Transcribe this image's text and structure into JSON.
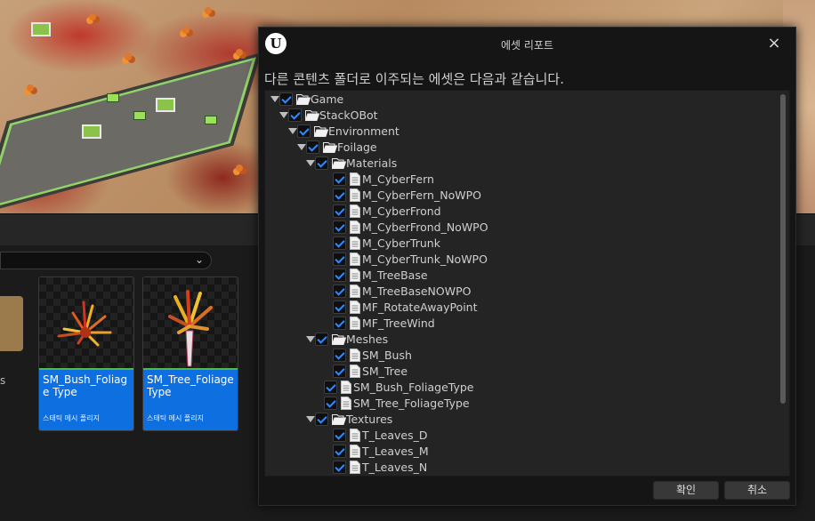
{
  "dialog": {
    "logo": "U",
    "title": "에셋 리포트",
    "close_icon": "×",
    "message": "다른 콘텐츠 폴더로 이주되는 에셋은 다음과 같습니다.",
    "tree": [
      {
        "label": "Game",
        "depth": 0,
        "kind": "folder",
        "expanded": true,
        "checked": true
      },
      {
        "label": "StackOBot",
        "depth": 1,
        "kind": "folder",
        "expanded": true,
        "checked": true
      },
      {
        "label": "Environment",
        "depth": 2,
        "kind": "folder",
        "expanded": true,
        "checked": true
      },
      {
        "label": "Foilage",
        "depth": 3,
        "kind": "folder",
        "expanded": true,
        "checked": true
      },
      {
        "label": "Materials",
        "depth": 4,
        "kind": "folder",
        "expanded": true,
        "checked": true
      },
      {
        "label": "M_CyberFern",
        "depth": 5,
        "kind": "file",
        "checked": true
      },
      {
        "label": "M_CyberFern_NoWPO",
        "depth": 5,
        "kind": "file",
        "checked": true
      },
      {
        "label": "M_CyberFrond",
        "depth": 5,
        "kind": "file",
        "checked": true
      },
      {
        "label": "M_CyberFrond_NoWPO",
        "depth": 5,
        "kind": "file",
        "checked": true
      },
      {
        "label": "M_CyberTrunk",
        "depth": 5,
        "kind": "file",
        "checked": true
      },
      {
        "label": "M_CyberTrunk_NoWPO",
        "depth": 5,
        "kind": "file",
        "checked": true
      },
      {
        "label": "M_TreeBase",
        "depth": 5,
        "kind": "file",
        "checked": true
      },
      {
        "label": "M_TreeBaseNOWPO",
        "depth": 5,
        "kind": "file",
        "checked": true
      },
      {
        "label": "MF_RotateAwayPoint",
        "depth": 5,
        "kind": "file",
        "checked": true
      },
      {
        "label": "MF_TreeWind",
        "depth": 5,
        "kind": "file",
        "checked": true
      },
      {
        "label": "Meshes",
        "depth": 4,
        "kind": "folder",
        "expanded": true,
        "checked": true
      },
      {
        "label": "SM_Bush",
        "depth": 5,
        "kind": "file",
        "checked": true
      },
      {
        "label": "SM_Tree",
        "depth": 5,
        "kind": "file",
        "checked": true
      },
      {
        "label": "SM_Bush_FoliageType",
        "depth": 4,
        "kind": "file",
        "checked": true
      },
      {
        "label": "SM_Tree_FoliageType",
        "depth": 4,
        "kind": "file",
        "checked": true
      },
      {
        "label": "Textures",
        "depth": 4,
        "kind": "folder",
        "expanded": true,
        "checked": true
      },
      {
        "label": "T_Leaves_D",
        "depth": 5,
        "kind": "file",
        "checked": true
      },
      {
        "label": "T_Leaves_M",
        "depth": 5,
        "kind": "file",
        "checked": true
      },
      {
        "label": "T_Leaves_N",
        "depth": 5,
        "kind": "file",
        "checked": true
      }
    ],
    "ok_label": "확인",
    "cancel_label": "취소"
  },
  "content_browser": {
    "side_text": "s",
    "assets": [
      {
        "name": "SM_Bush_Foliage Type",
        "type": "스태틱 메시 폴리지"
      },
      {
        "name": "SM_Tree_Foliage Type",
        "type": "스태틱 메시 폴리지"
      }
    ]
  },
  "colors": {
    "accent_blue": "#0e6fe0",
    "checkmark": "#2f8bff",
    "asset_border_green": "#53b848"
  },
  "icons": {
    "folder": "folder-open-icon",
    "file": "document-icon",
    "expand": "triangle-down-icon",
    "close": "close-icon",
    "dropdown": "chevron-down-icon"
  }
}
